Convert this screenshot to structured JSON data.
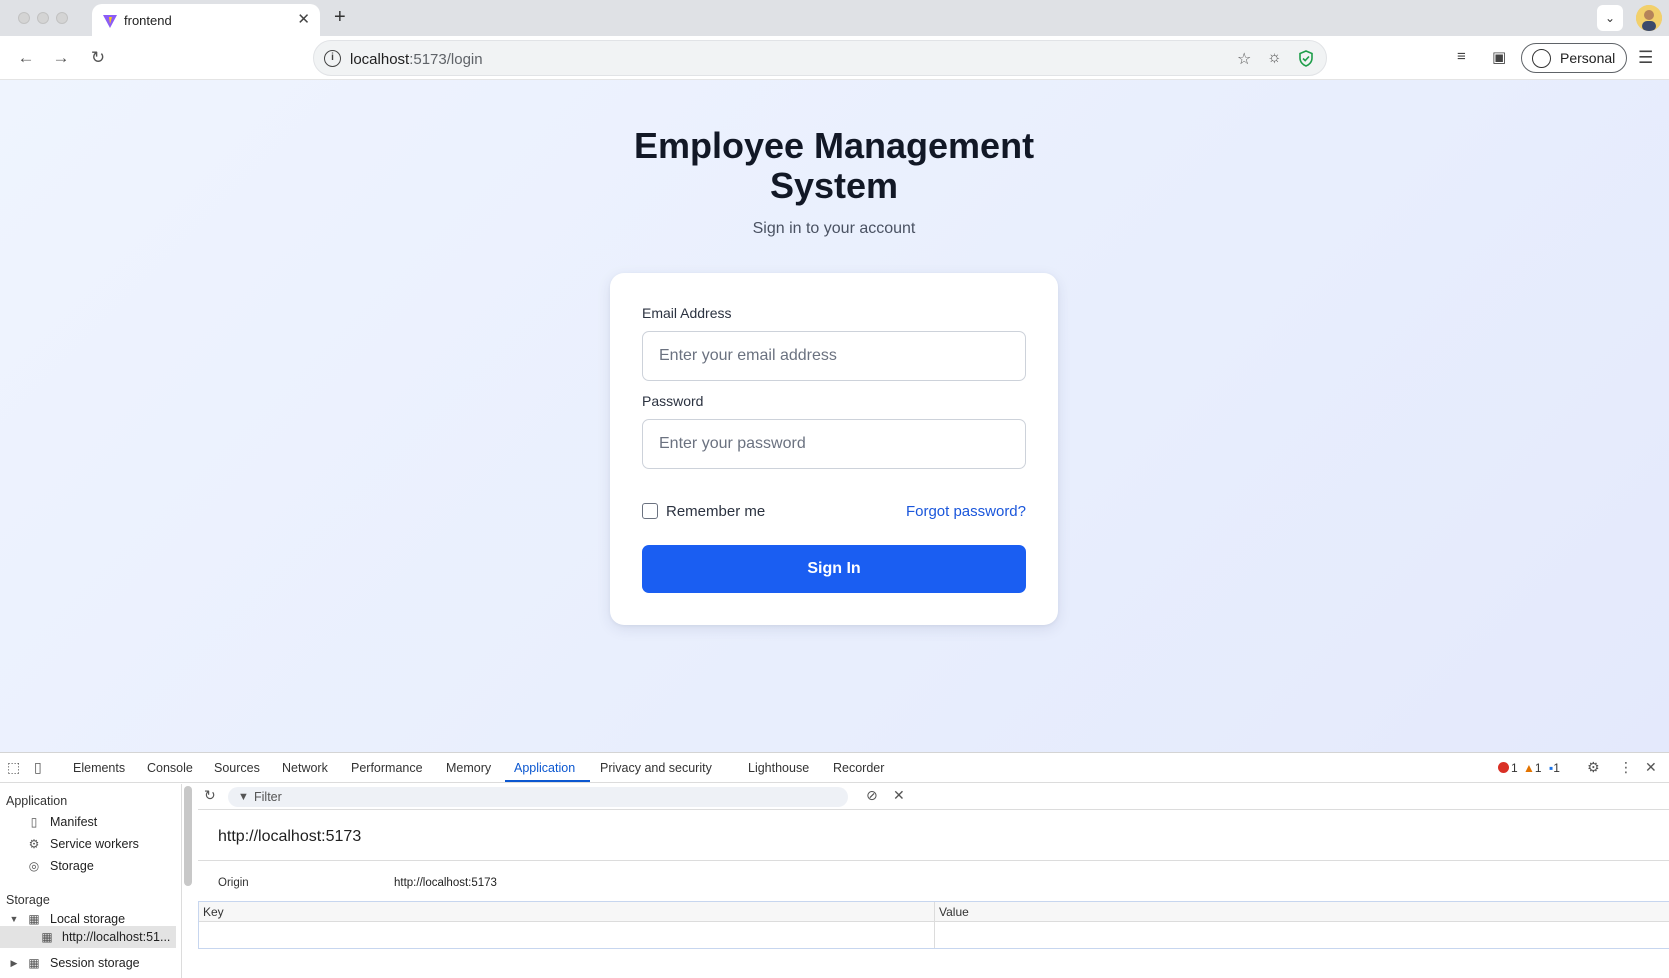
{
  "browser": {
    "tab_title": "frontend",
    "url_host": "localhost",
    "url_path": ":5173/login",
    "profile_label": "Personal"
  },
  "login": {
    "title_line1": "Employee Management",
    "title_line2": "System",
    "subtitle": "Sign in to your account",
    "email_label": "Email Address",
    "email_placeholder": "Enter your email address",
    "password_label": "Password",
    "password_placeholder": "Enter your password",
    "remember_label": "Remember me",
    "forgot_label": "Forgot password?",
    "signin_label": "Sign In",
    "accent_color": "#1a5ef2"
  },
  "devtools": {
    "tabs": [
      "Elements",
      "Console",
      "Sources",
      "Network",
      "Performance",
      "Memory",
      "Application",
      "Privacy and security",
      "Lighthouse",
      "Recorder"
    ],
    "active_tab": "Application",
    "errors": "1",
    "warnings": "1",
    "messages": "1",
    "filter_placeholder": "Filter",
    "sidebar": {
      "application_heading": "Application",
      "application_items": [
        "Manifest",
        "Service workers",
        "Storage"
      ],
      "storage_heading": "Storage",
      "local_storage": "Local storage",
      "local_storage_origin": "http://localhost:51...",
      "session_storage": "Session storage"
    },
    "origin_title": "http://localhost:5173",
    "origin_key": "Origin",
    "origin_value": "http://localhost:5173",
    "table_headers": [
      "Key",
      "Value"
    ]
  }
}
